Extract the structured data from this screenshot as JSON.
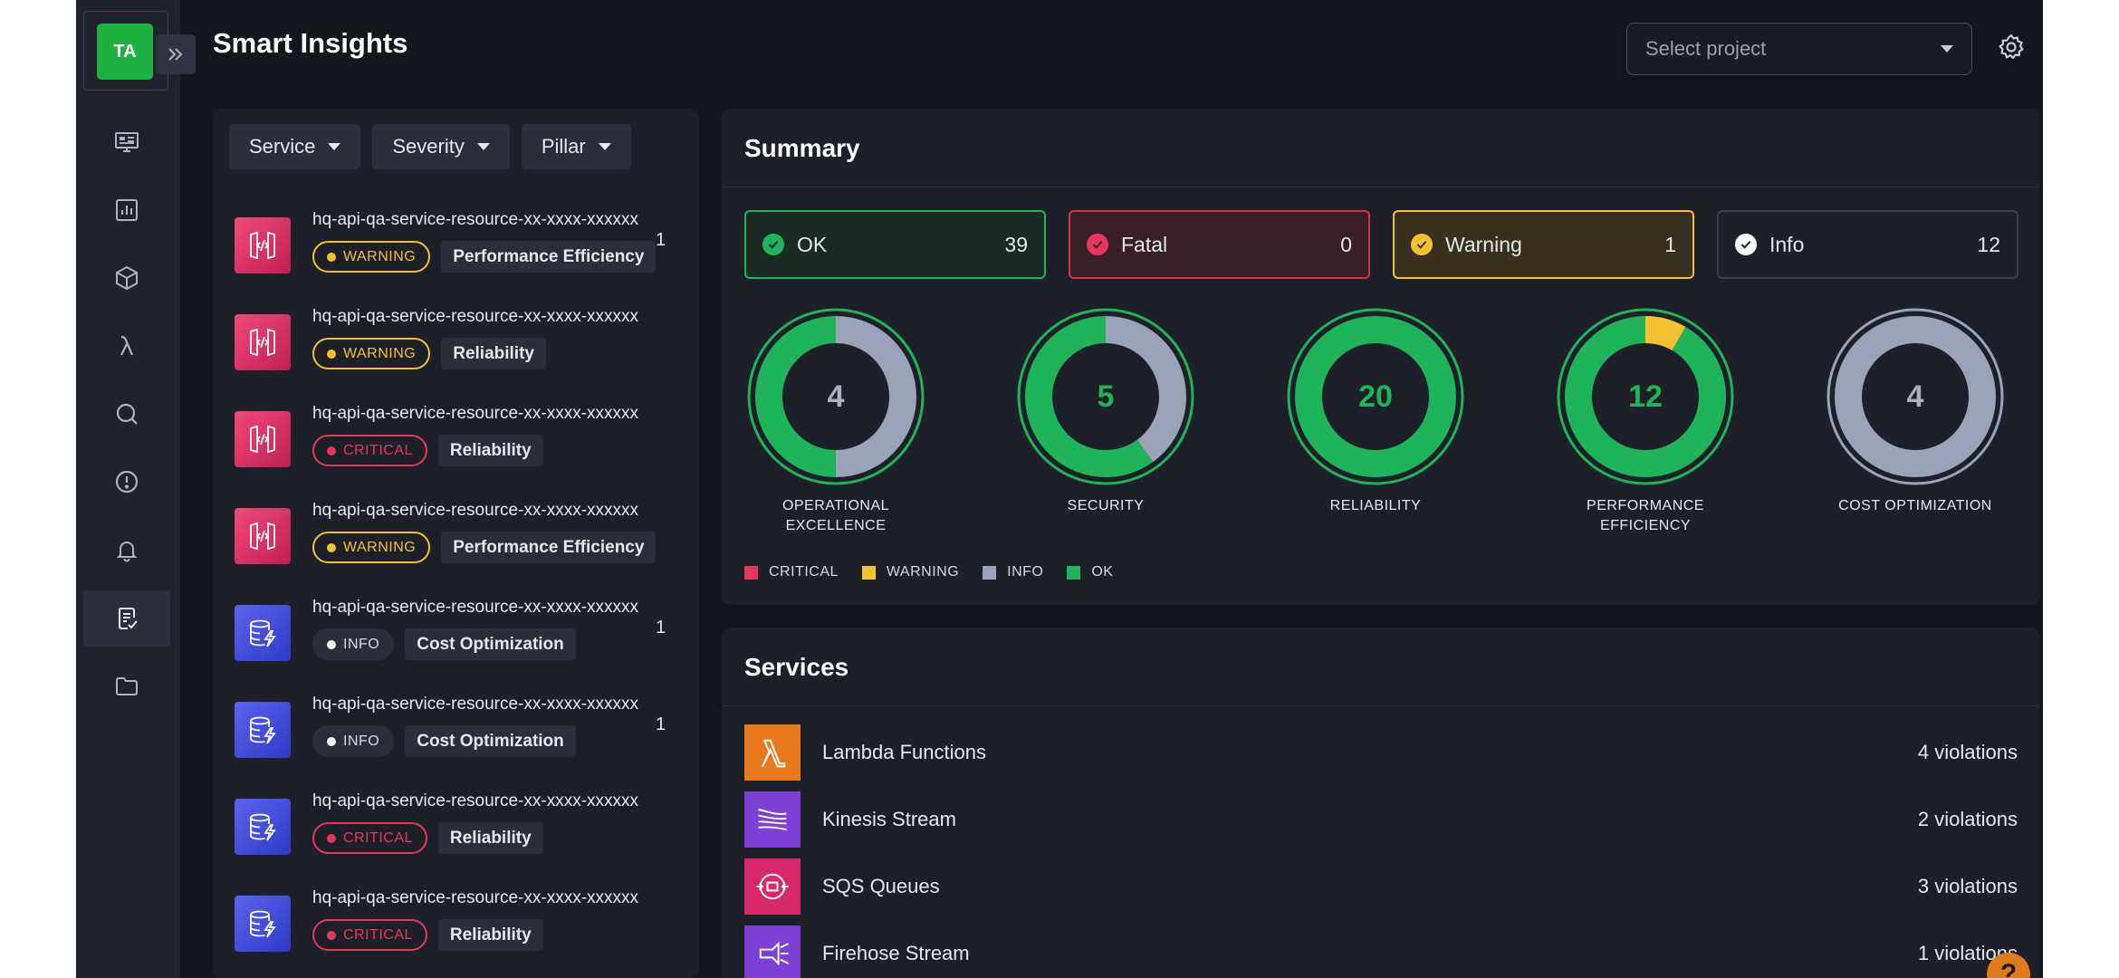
{
  "user": {
    "initials": "TA"
  },
  "header": {
    "title": "Smart Insights",
    "project_placeholder": "Select project"
  },
  "sidebar": {
    "items": [
      {
        "icon": "dashboard-icon",
        "active": false
      },
      {
        "icon": "chart-icon",
        "active": false
      },
      {
        "icon": "package-icon",
        "active": false
      },
      {
        "icon": "lambda-icon",
        "active": false
      },
      {
        "icon": "search-icon",
        "active": false
      },
      {
        "icon": "alert-icon",
        "active": false
      },
      {
        "icon": "bell-icon",
        "active": false
      },
      {
        "icon": "checklist-icon",
        "active": true
      },
      {
        "icon": "folder-icon",
        "active": false
      }
    ]
  },
  "filters": {
    "service": "Service",
    "severity": "Severity",
    "pillar": "Pillar"
  },
  "findings": [
    {
      "name": "hq-api-qa-service-resource-xx-xxxx-xxxxxx",
      "severity": "WARNING",
      "pillar": "Performance Efficiency",
      "count": "1",
      "icon": "api-gateway-icon"
    },
    {
      "name": "hq-api-qa-service-resource-xx-xxxx-xxxxxx",
      "severity": "WARNING",
      "pillar": "Reliability",
      "count": "",
      "icon": "api-gateway-icon"
    },
    {
      "name": "hq-api-qa-service-resource-xx-xxxx-xxxxxx",
      "severity": "CRITICAL",
      "pillar": "Reliability",
      "count": "",
      "icon": "api-gateway-icon"
    },
    {
      "name": "hq-api-qa-service-resource-xx-xxxx-xxxxxx",
      "severity": "WARNING",
      "pillar": "Performance Efficiency",
      "count": "",
      "icon": "api-gateway-icon"
    },
    {
      "name": "hq-api-qa-service-resource-xx-xxxx-xxxxxx",
      "severity": "INFO",
      "pillar": "Cost Optimization",
      "count": "1",
      "icon": "dynamodb-icon"
    },
    {
      "name": "hq-api-qa-service-resource-xx-xxxx-xxxxxx",
      "severity": "INFO",
      "pillar": "Cost Optimization",
      "count": "1",
      "icon": "dynamodb-icon"
    },
    {
      "name": "hq-api-qa-service-resource-xx-xxxx-xxxxxx",
      "severity": "CRITICAL",
      "pillar": "Reliability",
      "count": "",
      "icon": "dynamodb-icon"
    },
    {
      "name": "hq-api-qa-service-resource-xx-xxxx-xxxxxx",
      "severity": "CRITICAL",
      "pillar": "Reliability",
      "count": "",
      "icon": "dynamodb-icon"
    }
  ],
  "summary": {
    "title": "Summary",
    "stats": [
      {
        "key": "ok",
        "label": "OK",
        "value": "39"
      },
      {
        "key": "fatal",
        "label": "Fatal",
        "value": "0"
      },
      {
        "key": "warn",
        "label": "Warning",
        "value": "1"
      },
      {
        "key": "info",
        "label": "Info",
        "value": "12"
      }
    ],
    "donuts": [
      {
        "value": "4",
        "label_line1": "OPERATIONAL",
        "label_line2": "EXCELLENCE",
        "ok": 2,
        "info": 2,
        "warning": 0,
        "critical": 0,
        "value_color": "#aab1c2"
      },
      {
        "value": "5",
        "label_line1": "SECURITY",
        "label_line2": "",
        "ok": 3,
        "info": 2,
        "warning": 0,
        "critical": 0,
        "value_color": "#1fb35a"
      },
      {
        "value": "20",
        "label_line1": "RELIABILITY",
        "label_line2": "",
        "ok": 20,
        "info": 0,
        "warning": 0,
        "critical": 0,
        "value_color": "#1fb35a"
      },
      {
        "value": "12",
        "label_line1": "PERFORMANCE",
        "label_line2": "EFFICIENCY",
        "ok": 11,
        "info": 0,
        "warning": 1,
        "critical": 0,
        "value_color": "#1fb35a"
      },
      {
        "value": "4",
        "label_line1": "COST OPTIMIZATION",
        "label_line2": "",
        "ok": 0,
        "info": 4,
        "warning": 0,
        "critical": 0,
        "value_color": "#aab1c2"
      }
    ],
    "legend": [
      {
        "label": "CRITICAL",
        "color": "#e8365e"
      },
      {
        "label": "WARNING",
        "color": "#f2c230"
      },
      {
        "label": "INFO",
        "color": "#9aa3b8"
      },
      {
        "label": "OK",
        "color": "#1fb35a"
      }
    ]
  },
  "services": {
    "title": "Services",
    "items": [
      {
        "name": "Lambda Functions",
        "count": "4 violations",
        "icon": "lambda-icon",
        "color": "#e8791c"
      },
      {
        "name": "Kinesis Stream",
        "count": "2 violations",
        "icon": "kinesis-icon",
        "color": "#7e3fd4"
      },
      {
        "name": "SQS Queues",
        "count": "3 violations",
        "icon": "sqs-icon",
        "color": "#d8296a"
      },
      {
        "name": "Firehose Stream",
        "count": "1 violations",
        "icon": "firehose-icon",
        "color": "#7e3fd4"
      }
    ]
  },
  "help": {
    "label": "?"
  }
}
